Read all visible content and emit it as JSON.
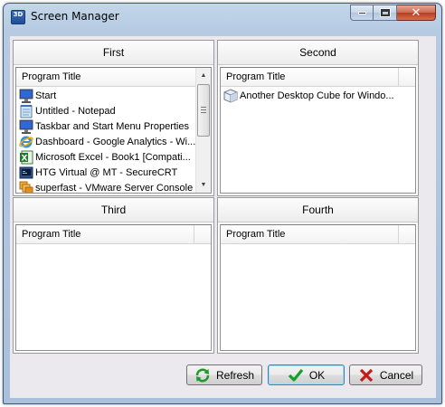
{
  "window": {
    "title": "Screen Manager",
    "app_icon": "3D"
  },
  "caption_buttons": {
    "minimize_icon": "minimize-icon",
    "maximize_icon": "maximize-icon",
    "close_glyph": "✕"
  },
  "panes": [
    {
      "title": "First",
      "column": "Program Title",
      "items": [
        {
          "label": "Start",
          "icon": "desktop-icon"
        },
        {
          "label": "Untitled - Notepad",
          "icon": "notepad-icon"
        },
        {
          "label": "Taskbar and Start Menu Properties",
          "icon": "desktop-icon"
        },
        {
          "label": "Dashboard - Google Analytics - Wi...",
          "icon": "ie-icon"
        },
        {
          "label": "Microsoft Excel - Book1  [Compati...",
          "icon": "excel-icon"
        },
        {
          "label": "HTG Virtual @ MT - SecureCRT",
          "icon": "securecrt-icon"
        },
        {
          "label": "superfast - VMware Server Console",
          "icon": "vmware-icon"
        }
      ]
    },
    {
      "title": "Second",
      "column": "Program Title",
      "items": [
        {
          "label": "Another Desktop Cube for Windo...",
          "icon": "cube-icon"
        }
      ]
    },
    {
      "title": "Third",
      "column": "Program Title",
      "items": []
    },
    {
      "title": "Fourth",
      "column": "Program Title",
      "items": []
    }
  ],
  "buttons": {
    "refresh": "Refresh",
    "ok": "OK",
    "cancel": "Cancel"
  }
}
